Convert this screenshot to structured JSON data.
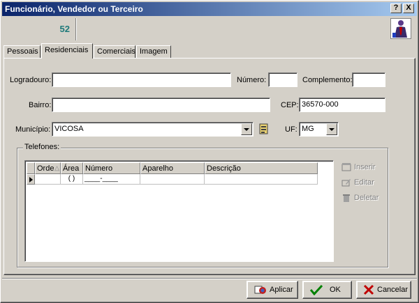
{
  "window": {
    "title": "Funcionário, Vendedor ou Terceiro",
    "help_button": "?",
    "close_button": "X"
  },
  "header": {
    "record_id": "52",
    "app_icon": "person-tie-icon"
  },
  "tabs": [
    {
      "label": "Pessoais",
      "active": false
    },
    {
      "label": "Residenciais",
      "active": true
    },
    {
      "label": "Comerciais",
      "active": false
    },
    {
      "label": "Imagem",
      "active": false
    }
  ],
  "form": {
    "logradouro_label": "Logradouro:",
    "logradouro_value": "",
    "numero_label": "Número:",
    "numero_value": "",
    "complemento_label": "Complemento:",
    "complemento_value": "",
    "bairro_label": "Bairro:",
    "bairro_value": "",
    "cep_label": "CEP:",
    "cep_value": "36570-000",
    "municipio_label": "Município:",
    "municipio_value": "VICOSA",
    "uf_label": "UF:",
    "uf_value": "MG"
  },
  "telefones": {
    "legend": "Telefones:",
    "columns": [
      "Orde",
      "Área",
      "Número",
      "Aparelho",
      "Descrição"
    ],
    "rows": [
      {
        "ordem": "",
        "area": "( )",
        "numero": "____-____",
        "aparelho": "",
        "descricao": ""
      }
    ],
    "actions": {
      "insert": "Inserir",
      "edit": "Editar",
      "delete": "Deletar"
    }
  },
  "buttons": {
    "apply": "Aplicar",
    "ok": "OK",
    "cancel": "Cancelar"
  },
  "colors": {
    "title_gradient_start": "#0a246a",
    "title_gradient_end": "#a6caf0",
    "record_id": "#1f7a7a",
    "face": "#d4d0c8"
  }
}
